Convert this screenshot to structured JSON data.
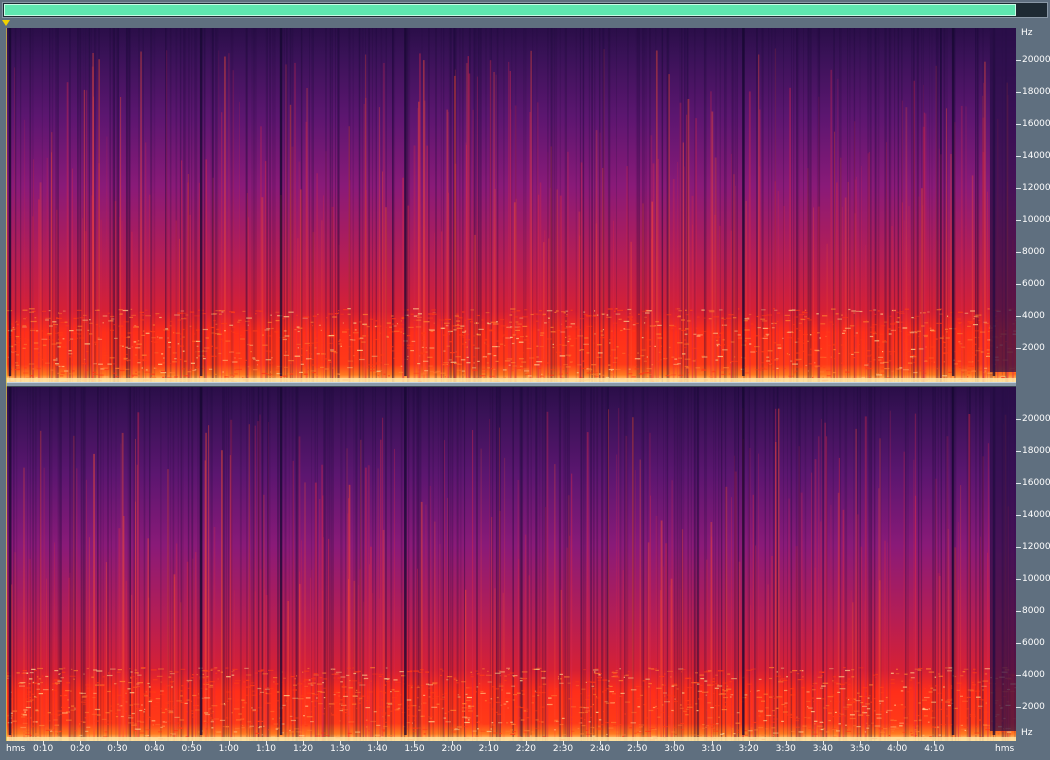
{
  "chart_data": {
    "type": "heatmap",
    "description_kind": "stereo audio spectrogram",
    "channels": 2,
    "x_axis": {
      "unit_label": "hms",
      "range_seconds": [
        0,
        272
      ],
      "ticks": [
        {
          "t": 10,
          "label": "0:10"
        },
        {
          "t": 20,
          "label": "0:20"
        },
        {
          "t": 30,
          "label": "0:30"
        },
        {
          "t": 40,
          "label": "0:40"
        },
        {
          "t": 50,
          "label": "0:50"
        },
        {
          "t": 60,
          "label": "1:00"
        },
        {
          "t": 70,
          "label": "1:10"
        },
        {
          "t": 80,
          "label": "1:20"
        },
        {
          "t": 90,
          "label": "1:30"
        },
        {
          "t": 100,
          "label": "1:40"
        },
        {
          "t": 110,
          "label": "1:50"
        },
        {
          "t": 120,
          "label": "2:00"
        },
        {
          "t": 130,
          "label": "2:10"
        },
        {
          "t": 140,
          "label": "2:20"
        },
        {
          "t": 150,
          "label": "2:30"
        },
        {
          "t": 160,
          "label": "2:40"
        },
        {
          "t": 170,
          "label": "2:50"
        },
        {
          "t": 180,
          "label": "3:00"
        },
        {
          "t": 190,
          "label": "3:10"
        },
        {
          "t": 200,
          "label": "3:20"
        },
        {
          "t": 210,
          "label": "3:30"
        },
        {
          "t": 220,
          "label": "3:40"
        },
        {
          "t": 230,
          "label": "3:50"
        },
        {
          "t": 240,
          "label": "4:00"
        },
        {
          "t": 250,
          "label": "4:10"
        }
      ]
    },
    "y_axis": {
      "unit_label": "Hz",
      "range_hz": [
        0,
        22000
      ],
      "ticks": [
        {
          "f": 2000,
          "label": "2000"
        },
        {
          "f": 4000,
          "label": "4000"
        },
        {
          "f": 6000,
          "label": "6000"
        },
        {
          "f": 8000,
          "label": "8000"
        },
        {
          "f": 10000,
          "label": "10000"
        },
        {
          "f": 12000,
          "label": "12000"
        },
        {
          "f": 14000,
          "label": "14000"
        },
        {
          "f": 16000,
          "label": "16000"
        },
        {
          "f": 18000,
          "label": "18000"
        },
        {
          "f": 20000,
          "label": "20000"
        }
      ]
    },
    "colormap": [
      "#1a0a3a",
      "#3a1060",
      "#6a1a80",
      "#a0207a",
      "#d8203a",
      "#ff3a10",
      "#ff9a30",
      "#ffe89a"
    ],
    "energy_profile": {
      "low_band_hz": [
        0,
        4500
      ],
      "low_band_intensity": 0.85,
      "mid_band_hz": [
        4500,
        10000
      ],
      "mid_band_intensity": 0.55,
      "high_band_hz": [
        10000,
        22000
      ],
      "high_band_intensity": 0.35,
      "dark_gaps_seconds": [
        1,
        52.5,
        74,
        107.5,
        198.5,
        255,
        266
      ],
      "fade_out_seconds": [
        265,
        272
      ]
    }
  },
  "colors": {
    "background": "#5f6f7f",
    "overview_bar": "#5fe6b0",
    "playhead": "#f2d200",
    "axis_text": "#ffffff"
  }
}
